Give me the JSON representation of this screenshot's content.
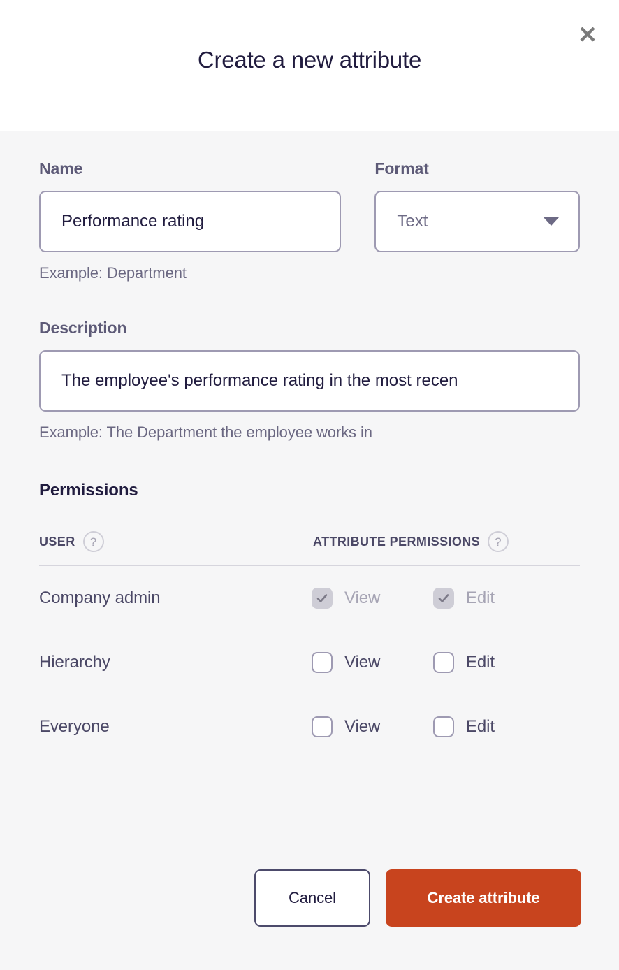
{
  "dialog": {
    "title": "Create a new attribute",
    "close_icon": "close-icon"
  },
  "form": {
    "name": {
      "label": "Name",
      "value": "Performance rating",
      "placeholder": "",
      "hint": "Example: Department"
    },
    "format": {
      "label": "Format",
      "value": "Text",
      "caret_icon": "chevron-down-icon"
    },
    "description": {
      "label": "Description",
      "value": "The employee's performance rating in the most recen",
      "placeholder": "",
      "hint": "Example: The Department the employee works in"
    }
  },
  "permissions": {
    "heading": "Permissions",
    "columns": {
      "user": "User",
      "user_help_icon": "help-circle-icon",
      "attribute_permissions": "Attribute permissions",
      "attribute_permissions_help_icon": "help-circle-icon",
      "help_glyph": "?"
    },
    "rows": [
      {
        "user": "Company admin",
        "view_label": "View",
        "edit_label": "Edit",
        "view_checked": true,
        "edit_checked": true,
        "disabled": true
      },
      {
        "user": "Hierarchy",
        "view_label": "View",
        "edit_label": "Edit",
        "view_checked": false,
        "edit_checked": false,
        "disabled": false
      },
      {
        "user": "Everyone",
        "view_label": "View",
        "edit_label": "Edit",
        "view_checked": false,
        "edit_checked": false,
        "disabled": false
      }
    ]
  },
  "footer": {
    "cancel_label": "Cancel",
    "submit_label": "Create attribute"
  },
  "colors": {
    "accent": "#c8441e",
    "title_text": "#211c3f",
    "label_text": "#5d5a77",
    "hint_text": "#6b6882",
    "border": "#9e9ab2",
    "body_bg": "#f6f6f7",
    "header_bg": "#ffffff",
    "checkbox_disabled": "#cecdd6"
  }
}
